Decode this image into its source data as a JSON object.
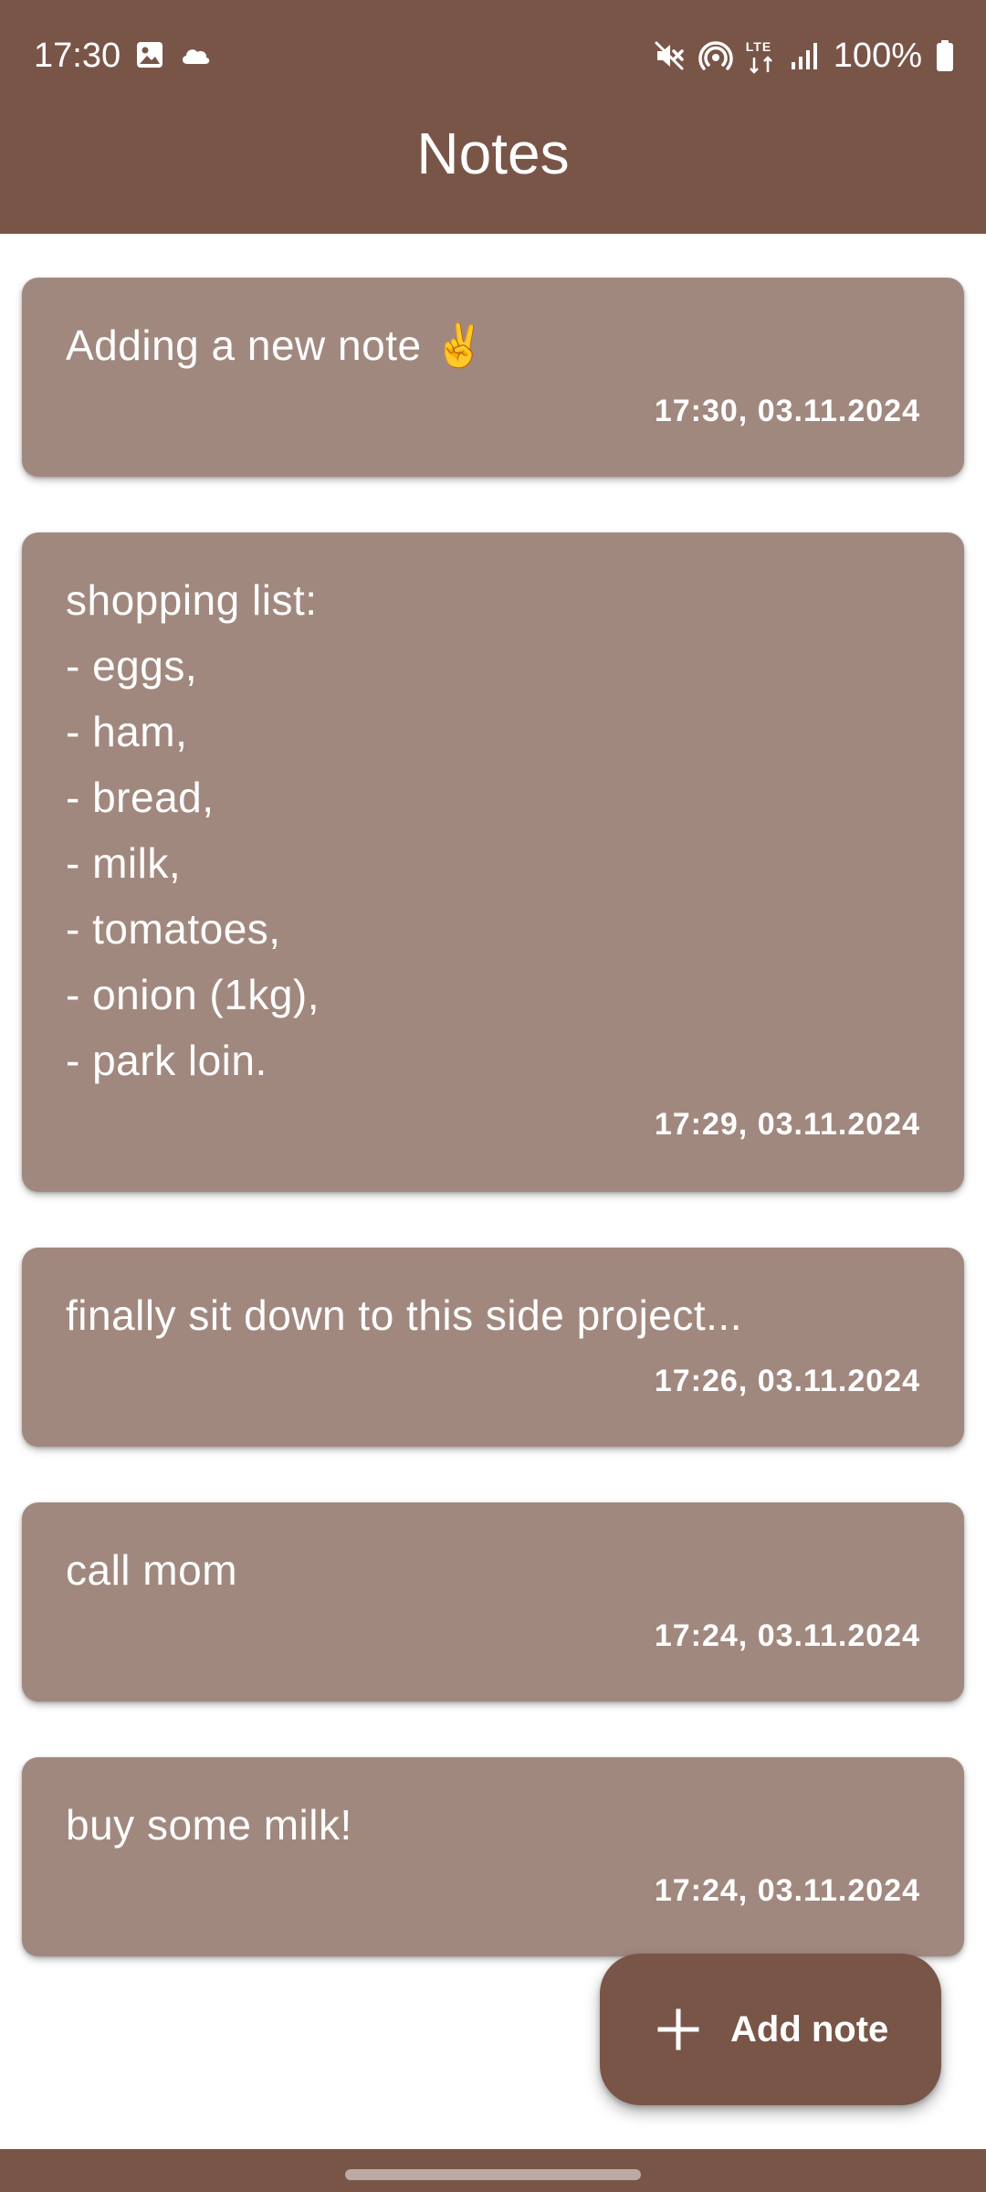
{
  "status_bar": {
    "time": "17:30",
    "left_icons": [
      "gallery-icon",
      "cloud-icon"
    ],
    "right_icons": [
      "mute-icon",
      "hotspot-icon",
      "lte-icon",
      "signal-icon",
      "battery-icon"
    ],
    "lte_label": "LTE",
    "battery": "100%"
  },
  "app_bar": {
    "title": "Notes"
  },
  "notes": [
    {
      "text": "Adding a new note ✌️",
      "date": "17:30, 03.11.2024"
    },
    {
      "text": "shopping list:\n- eggs,\n- ham,\n- bread,\n- milk,\n- tomatoes,\n- onion (1kg),\n- park loin.",
      "date": "17:29, 03.11.2024"
    },
    {
      "text": "finally sit down to this side project...",
      "date": "17:26, 03.11.2024"
    },
    {
      "text": "call mom",
      "date": "17:24, 03.11.2024"
    },
    {
      "text": "buy some milk!",
      "date": "17:24, 03.11.2024"
    }
  ],
  "fab": {
    "label": "Add note",
    "icon": "plus-icon"
  },
  "colors": {
    "primary": "#795548",
    "card": "#a1887f",
    "on_primary": "#ffffff"
  }
}
